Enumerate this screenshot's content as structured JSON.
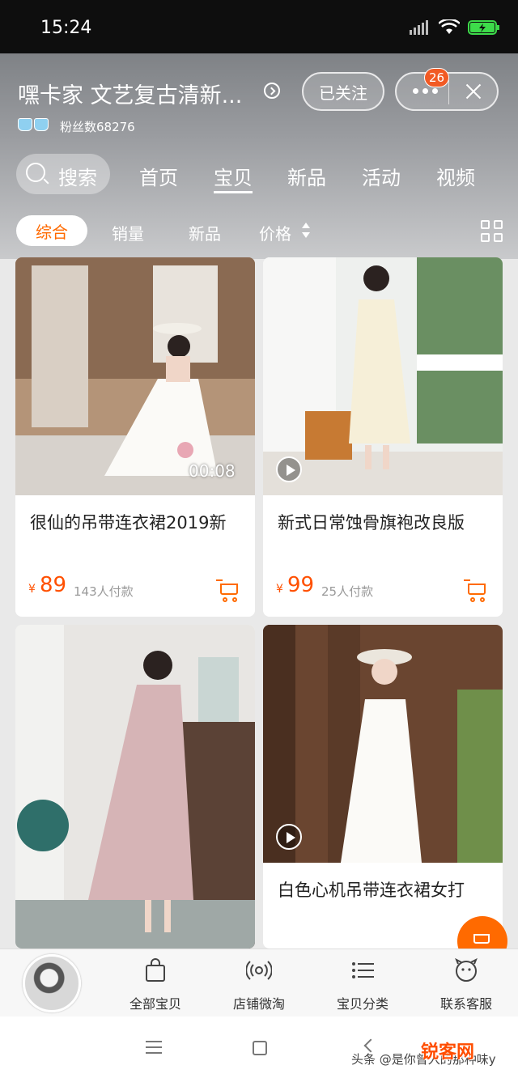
{
  "status_bar": {
    "time": "15:24"
  },
  "header": {
    "shop_name": "嘿卡家 文艺复古清新...",
    "fans_label": "粉丝数68276",
    "follow_label": "已关注",
    "message_badge": "26"
  },
  "nav": {
    "search_label": "搜索",
    "tabs": [
      {
        "label": "首页"
      },
      {
        "label": "宝贝"
      },
      {
        "label": "新品"
      },
      {
        "label": "活动"
      },
      {
        "label": "视频"
      }
    ]
  },
  "filter": {
    "items": [
      {
        "label": "综合"
      },
      {
        "label": "销量"
      },
      {
        "label": "新品"
      },
      {
        "label": "价格"
      }
    ]
  },
  "products": [
    {
      "name": "很仙的吊带连衣裙2019新",
      "currency": "¥",
      "price": "89",
      "sales": "143人付款",
      "video_time": "00:08"
    },
    {
      "name": "新式日常蚀骨旗袍改良版",
      "currency": "¥",
      "price": "99",
      "sales": "25人付款"
    },
    {
      "name": "",
      "currency": "",
      "price": "",
      "sales": ""
    },
    {
      "name": "白色心机吊带连衣裙女打",
      "currency": "",
      "price": "",
      "sales": ""
    }
  ],
  "shop_bar": {
    "items": [
      {
        "label": "全部宝贝"
      },
      {
        "label": "店铺微淘"
      },
      {
        "label": "宝贝分类"
      },
      {
        "label": "联系客服"
      }
    ]
  },
  "watermark": {
    "text": "头条 @是你曾入的那种味y",
    "logo": "锐客网"
  },
  "colors": {
    "accent": "#ff6a00",
    "price": "#ff5000"
  }
}
